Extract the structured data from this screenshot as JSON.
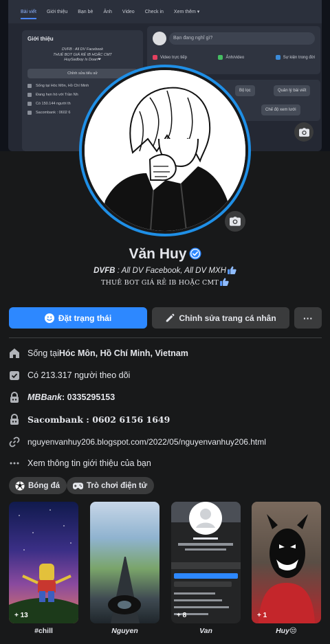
{
  "cover": {
    "nav_tabs": [
      "Bài viết",
      "Giới thiệu",
      "Bạn bè",
      "Ảnh",
      "Video",
      "Check in",
      "Xem thêm ▾"
    ],
    "intro_title": "Giới thiệu",
    "intro_bio_1": "DVFB : All DV Facebook",
    "intro_bio_2": "THUÊ BOT GIÁ RẺ IB HOẶC CMT",
    "intro_bio_3": "HuySadboy Is Doan❤",
    "edit_bio": "Chỉnh sửa tiểu sử",
    "line1": "Sống tại Hóc Môn, Hồ Chí Minh",
    "line2": "Đang hẹn hò với Trần Nh",
    "line3": "Có 150.144 người th",
    "line4": "Sacombank : 0602 6",
    "think": "Bạn đang nghĩ gì?",
    "action_live": "Video trực tiếp",
    "action_photo": "Ảnh/video",
    "action_event": "Sự kiện trong đời",
    "filter": "Bộ lọc",
    "manage": "Quản lý bài viết",
    "grid_view": "Chế độ xem lưới"
  },
  "profile": {
    "name": "Văn Huy",
    "bio_line1_bold": "DVFB",
    "bio_line1_rest": " : All DV Facebook, All DV MXH",
    "bio_line2": "THUÊ BOT GIÁ RẺ IB HOẶC CMT"
  },
  "buttons": {
    "status": "Đặt trạng thái",
    "edit": "Chỉnh sửa trang cá nhân",
    "more": "···"
  },
  "details": {
    "lives_prefix": "Sống tại ",
    "lives_place": "Hóc Môn, Hồ Chí Minh, Vietnam",
    "followers": "Có 213.317 người theo dõi",
    "mbbank_label": "MBBank",
    "mbbank_rest": " : 0335295153",
    "sacombank": "Sacombank : 0602 6156 1649",
    "link": "nguyenvanhuy206.blogspot.com/2022/05/nguyenvanhuy206.html",
    "see_intro": "Xem thông tin giới thiệu của bạn"
  },
  "hobbies": [
    {
      "label": "Bóng đá",
      "icon": "soccer-ball-icon"
    },
    {
      "label": "Trò chơi điện tử",
      "icon": "gamepad-icon"
    }
  ],
  "featured": [
    {
      "caption": "#chill",
      "count": "+ 13"
    },
    {
      "caption": "Nguyen",
      "count": ""
    },
    {
      "caption": "Van",
      "count": "+ 8"
    },
    {
      "caption": "Huy😒",
      "count": "+ 1"
    }
  ],
  "colors": {
    "background": "#18191a",
    "primary_button": "#2d88ff",
    "secondary_button": "#3a3b3c",
    "avatar_ring": "#1f8fe6",
    "text": "#e4e6eb"
  }
}
